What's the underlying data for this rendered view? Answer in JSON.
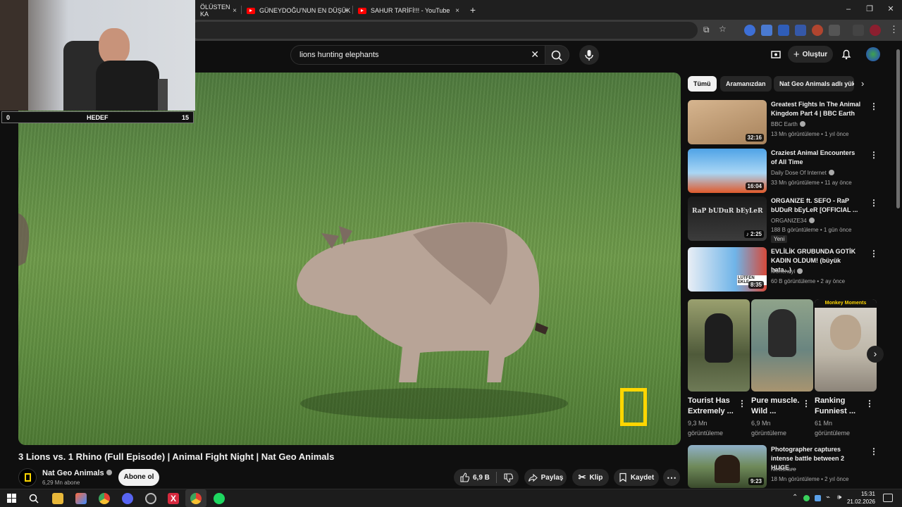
{
  "browser": {
    "tabs": [
      {
        "label": "ÖLÜSTEN KA"
      },
      {
        "label": "GÜNEYDOĞU'NUN EN DÜŞÜK"
      },
      {
        "label": "SAHUR TARİFİ!!! - YouTube"
      }
    ],
    "new_tab": "+",
    "close_glyph": "×"
  },
  "search": {
    "query": "lions hunting elephants"
  },
  "header": {
    "create_label": "Oluştur"
  },
  "overlay": {
    "goal_label": "HEDEF",
    "goal_current": "0",
    "goal_target": "15"
  },
  "video": {
    "title": "3 Lions vs. 1 Rhino (Full Episode) | Animal Fight Night | Nat Geo Animals",
    "channel": "Nat Geo Animals",
    "subscribers": "6,29 Mn abone",
    "subscribe_label": "Abone ol",
    "likes": "6,9 B",
    "share_label": "Paylaş",
    "clip_label": "Klip",
    "save_label": "Kaydet"
  },
  "chips": [
    "Tümü",
    "Aramanızdan",
    "Nat Geo Animals adlı yük"
  ],
  "recommendations": [
    {
      "title": "Greatest Fights In The Animal Kingdom Part 4 | BBC Earth",
      "channel": "BBC Earth",
      "meta": "13 Mn görüntüleme • 1 yıl önce",
      "duration": "32:16"
    },
    {
      "title": "Craziest Animal Encounters of All Time",
      "channel": "Daily Dose Of Internet",
      "meta": "33 Mn görüntüleme • 11 ay önce",
      "duration": "16:04"
    },
    {
      "title": "ORGANIZE ft. SEFO - RaP bUDuR bEyLeR [OFFICIAL ...",
      "channel": "ORGANIZE34",
      "meta": "188 B görüntüleme • 1 gün önce",
      "duration": "2:25",
      "badge": "Yeni",
      "thumb_text": "RaP bUDuR bEyLeR"
    },
    {
      "title": "EVLİLİK GRUBUNDA GOTİK KADIN OLDUM! (büyük hata...)",
      "channel": "Monchayi",
      "meta": "60 B görüntüleme • 2 ay önce",
      "duration": "8:35",
      "thumb_text": "LÜTFEN EKLE"
    },
    {
      "title": "Photographer captures intense battle between 2 HUGE ...",
      "channel": "Newsflare",
      "meta": "18 Mn görüntüleme • 2 yıl önce",
      "duration": "9:23"
    }
  ],
  "shorts": [
    {
      "title": "Tourist Has Extremely ...",
      "views": "9,3 Mn görüntüleme"
    },
    {
      "title": "Pure muscle. Wild ...",
      "views": "6,9 Mn görüntüleme"
    },
    {
      "title": "Ranking Funniest ...",
      "views": "61 Mn görüntüleme",
      "thumb_text": "Monkey Moments"
    }
  ],
  "taskbar": {
    "time": "15:31",
    "date": "21.02.2026"
  },
  "colors": {
    "bg": "#0f0f0f",
    "yt_red": "#ff0000",
    "natgeo_yellow": "#ffd600"
  }
}
